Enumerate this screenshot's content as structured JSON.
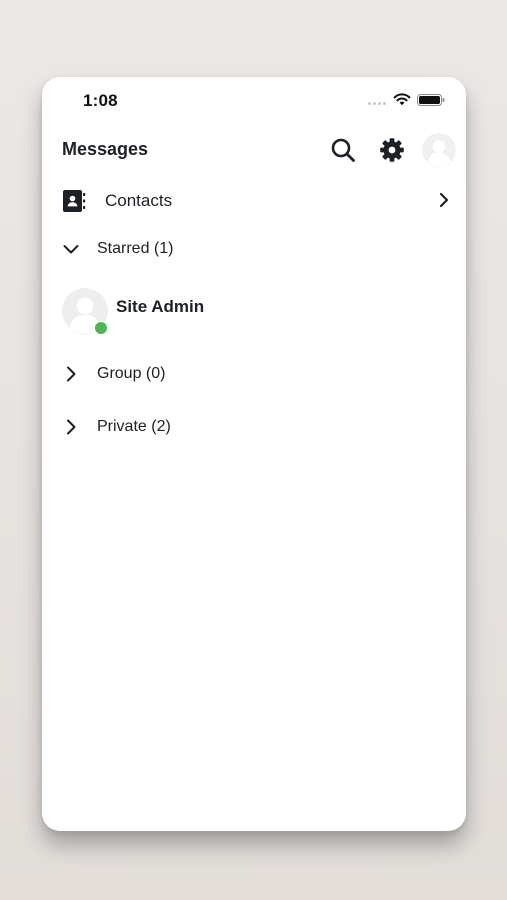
{
  "status_bar": {
    "time": "1:08"
  },
  "header": {
    "title": "Messages",
    "icons": [
      "search-icon",
      "gear-icon",
      "avatar"
    ]
  },
  "contacts": {
    "label": "Contacts"
  },
  "sections": {
    "starred": {
      "label": "Starred (1)",
      "expanded": true
    },
    "group": {
      "label": "Group (0)",
      "expanded": false
    },
    "private": {
      "label": "Private (2)",
      "expanded": false
    }
  },
  "starred_items": [
    {
      "name": "Site Admin",
      "online": true
    }
  ],
  "colors": {
    "background": "#e8e4e1",
    "text": "#1d2125",
    "online": "#4cb652",
    "icon": "#1d2125"
  }
}
